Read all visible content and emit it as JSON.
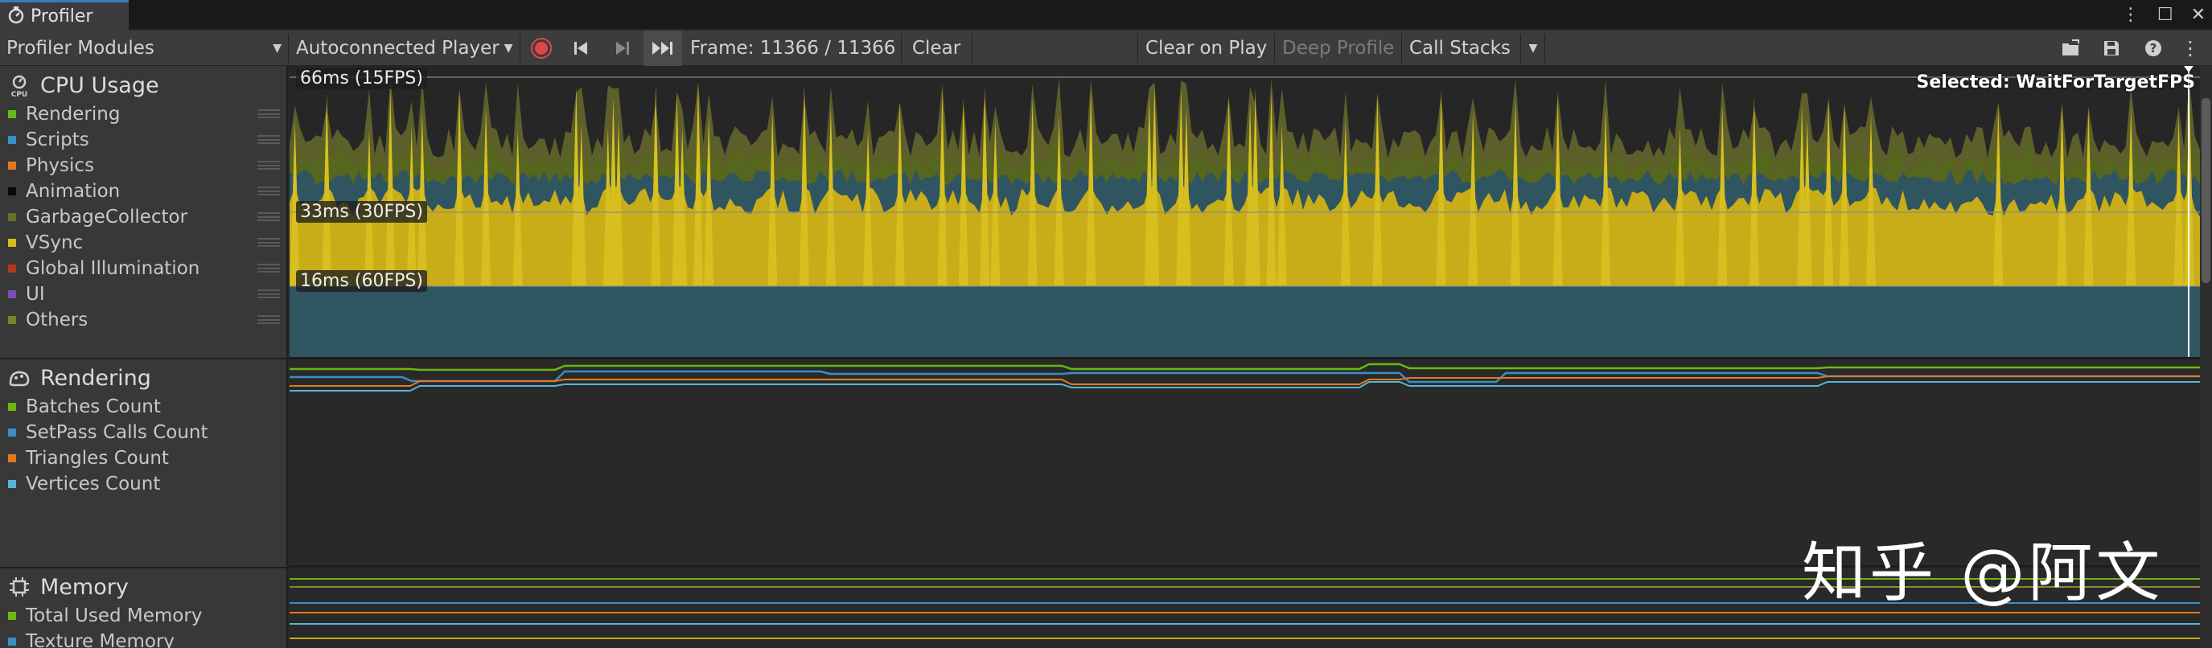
{
  "window": {
    "tab_title": "Profiler",
    "controls": {
      "more": "⋮",
      "maximize": "☐",
      "close": "✕"
    }
  },
  "toolbar": {
    "modules_dropdown": "Profiler Modules",
    "player_dropdown": "Autoconnected Player",
    "frame_label": "Frame: 11366 / 11366",
    "clear": "Clear",
    "clear_on_play": "Clear on Play",
    "deep_profile": "Deep Profile",
    "call_stacks": "Call Stacks"
  },
  "modules": {
    "cpu": {
      "title": "CPU Usage",
      "legend": [
        {
          "label": "Rendering",
          "color": "#6ab814"
        },
        {
          "label": "Scripts",
          "color": "#3a8fc6"
        },
        {
          "label": "Physics",
          "color": "#e07b1c"
        },
        {
          "label": "Animation",
          "color": "#0a0a0a"
        },
        {
          "label": "GarbageCollector",
          "color": "#6a6d2a"
        },
        {
          "label": "VSync",
          "color": "#d9b91e"
        },
        {
          "label": "Global Illumination",
          "color": "#b03a18"
        },
        {
          "label": "UI",
          "color": "#7a4fb8"
        },
        {
          "label": "Others",
          "color": "#6e8a25"
        }
      ],
      "fps_lines": [
        "66ms (15FPS)",
        "33ms (30FPS)",
        "16ms (60FPS)"
      ],
      "selected": "Selected: WaitForTargetFPS"
    },
    "rendering": {
      "title": "Rendering",
      "legend": [
        {
          "label": "Batches Count",
          "color": "#6ab814"
        },
        {
          "label": "SetPass Calls Count",
          "color": "#3a8fc6"
        },
        {
          "label": "Triangles Count",
          "color": "#e07b1c"
        },
        {
          "label": "Vertices Count",
          "color": "#5ab4d6"
        }
      ]
    },
    "memory": {
      "title": "Memory",
      "legend": [
        {
          "label": "Total Used Memory",
          "color": "#6ab814"
        },
        {
          "label": "Texture Memory",
          "color": "#3a8fc6"
        }
      ]
    }
  },
  "watermark": "知乎 @阿文"
}
